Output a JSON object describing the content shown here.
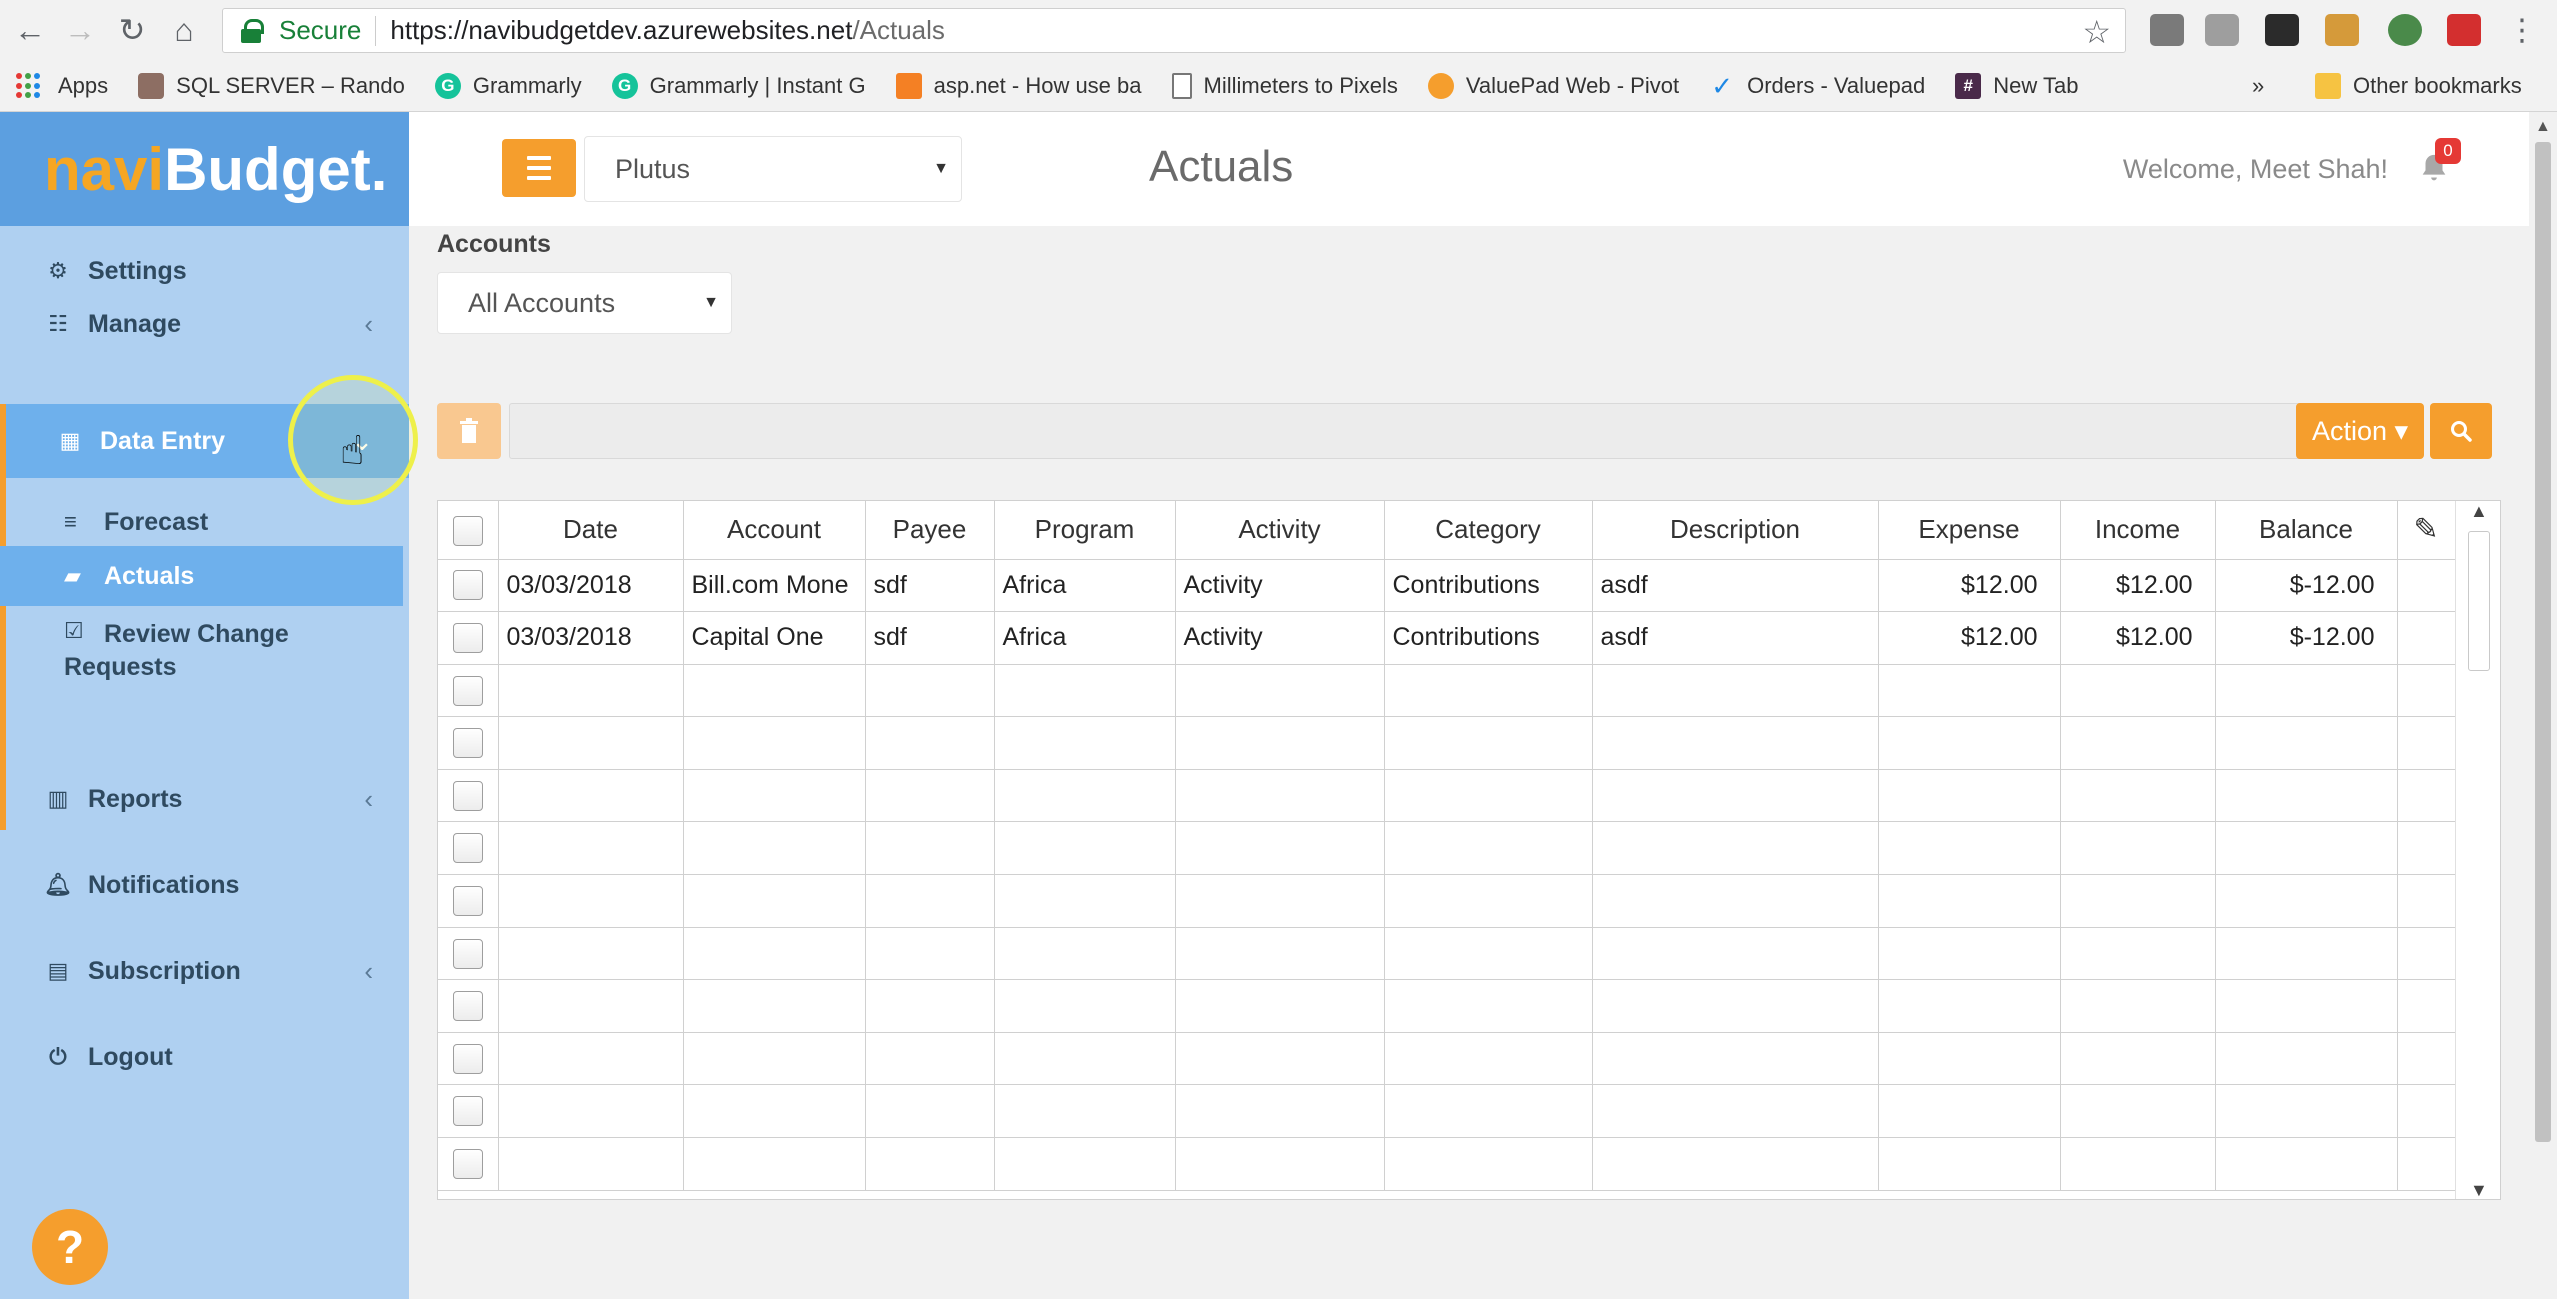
{
  "browser": {
    "secure_label": "Secure",
    "url_base": "https://navibudgetdev.azurewebsites.net",
    "url_path": "/Actuals",
    "bookmarks": [
      {
        "label": "Apps"
      },
      {
        "label": "SQL SERVER – Rando"
      },
      {
        "label": "Grammarly"
      },
      {
        "label": "Grammarly | Instant G"
      },
      {
        "label": "asp.net - How use ba"
      },
      {
        "label": "Millimeters to Pixels"
      },
      {
        "label": "ValuePad Web - Pivot"
      },
      {
        "label": "Orders - Valuepad"
      },
      {
        "label": "New Tab"
      }
    ],
    "more_label": "»",
    "other_bookmarks": "Other bookmarks"
  },
  "brand": {
    "navi": "navi",
    "budget": "Budget."
  },
  "sidebar": {
    "items": [
      {
        "label": "Settings",
        "icon": "cogs-icon"
      },
      {
        "label": "Manage",
        "icon": "manage-icon",
        "chevron": "‹"
      },
      {
        "label": "Data Entry",
        "icon": "table-icon",
        "chevron": "⌄"
      },
      {
        "label": "Reports",
        "icon": "bar-chart-icon",
        "chevron": "‹"
      },
      {
        "label": "Notifications",
        "icon": "bell-icon"
      },
      {
        "label": "Subscription",
        "icon": "card-icon",
        "chevron": "‹"
      },
      {
        "label": "Logout",
        "icon": "power-icon"
      }
    ],
    "sub_items": [
      {
        "label": "Forecast",
        "icon": "database-icon"
      },
      {
        "label": "Actuals",
        "icon": "book-icon"
      },
      {
        "label_line1": "Review Change",
        "label_line2": "Requests",
        "icon": "check-square-icon"
      }
    ],
    "help_label": "?"
  },
  "topbar": {
    "org_selected": "Plutus",
    "page_title": "Actuals",
    "welcome": "Welcome, Meet Shah!",
    "notification_count": "0"
  },
  "filters": {
    "accounts_label": "Accounts",
    "accounts_selected": "All Accounts"
  },
  "toolbar": {
    "action_label": "Action ▾"
  },
  "grid": {
    "columns": [
      "Date",
      "Account",
      "Payee",
      "Program",
      "Activity",
      "Category",
      "Description",
      "Expense",
      "Income",
      "Balance"
    ],
    "rows": [
      [
        "03/03/2018",
        "Bill.com Mone",
        "sdf",
        "Africa",
        "Activity",
        "Contributions",
        "asdf",
        "$12.00",
        "$12.00",
        "$-12.00"
      ],
      [
        "03/03/2018",
        "Capital One",
        "sdf",
        "Africa",
        "Activity",
        "Contributions",
        "asdf",
        "$12.00",
        "$12.00",
        "$-12.00"
      ]
    ],
    "empty_rows": 10
  },
  "colors": {
    "accent": "#f59e2d",
    "sidebar_bg": "#afd0f1",
    "sidebar_active": "#6eb0ec",
    "brand_bg": "#5c9fe0"
  }
}
